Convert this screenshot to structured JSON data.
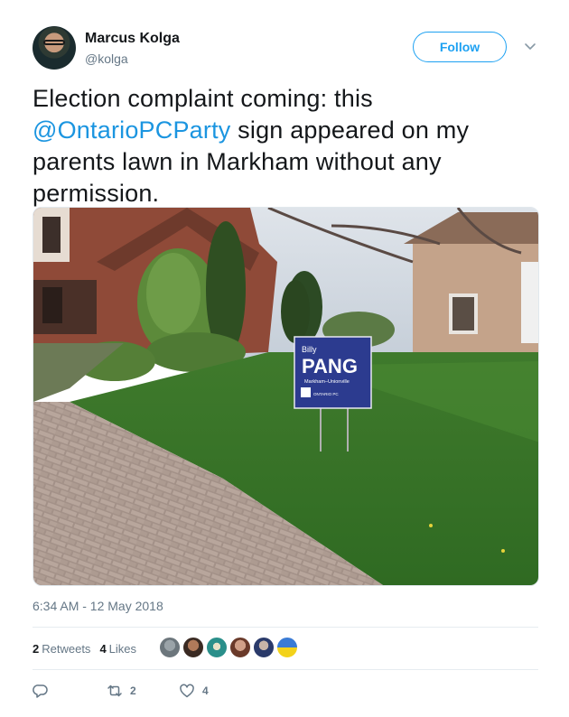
{
  "author": {
    "name": "Marcus Kolga",
    "handle": "@kolga"
  },
  "follow_label": "Follow",
  "tweet": {
    "text_before": "Election complaint coming: this ",
    "mention": "@OntarioPCParty",
    "text_after": " sign appeared on my parents lawn in Markham without any permission."
  },
  "photo": {
    "sign_top": "Billy",
    "sign_name": "PANG",
    "sign_riding": "Markham–Unionville",
    "sign_party": "ONTARIO PC"
  },
  "timestamp": "6:34 AM - 12 May 2018",
  "stats": {
    "retweets_count": "2",
    "retweets_label": "Retweets",
    "likes_count": "4",
    "likes_label": "Likes"
  },
  "actions": {
    "reply_count": "",
    "retweet_count": "2",
    "like_count": "4"
  },
  "colors": {
    "accent": "#1da1f2",
    "link": "#1b95e0",
    "muted": "#657786",
    "sign_blue": "#2c3b8f"
  },
  "icons": {
    "caret": "chevron-down-icon",
    "reply": "reply-icon",
    "retweet": "retweet-icon",
    "like": "heart-icon"
  }
}
